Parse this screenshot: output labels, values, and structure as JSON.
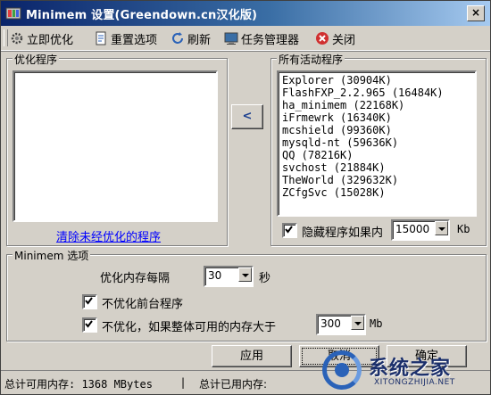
{
  "window": {
    "title": "Minimem 设置(Greendown.cn汉化版)",
    "close_label": "×"
  },
  "toolbar": {
    "optimize_now": "立即优化",
    "reset_options": "重置选项",
    "refresh": "刷新",
    "task_manager": "任务管理器",
    "close": "关闭"
  },
  "optimized_panel": {
    "title": "优化程序",
    "clear_link": "清除未经优化的程序",
    "items": []
  },
  "transfer_button": "<",
  "processes_panel": {
    "title": "所有活动程序",
    "items": [
      "Explorer (30904K)",
      "FlashFXP_2.2.965 (16484K)",
      "ha_minimem (22168K)",
      "iFrmewrk (16340K)",
      "mcshield (99360K)",
      "mysqld-nt (59636K)",
      "QQ (78216K)",
      "svchost (21884K)",
      "TheWorld (329632K)",
      "ZCfgSvc (15028K)"
    ],
    "hide_label": "隐藏程序如果内",
    "hide_checked": true,
    "hide_value": "15000",
    "hide_unit": "Kb"
  },
  "options": {
    "title": "Minimem 选项",
    "interval_label": "优化内存每隔",
    "interval_value": "30",
    "interval_unit": "秒",
    "no_foreground_label": "不优化前台程序",
    "no_foreground_checked": true,
    "threshold_label": "不优化，如果整体可用的内存大于",
    "threshold_checked": true,
    "threshold_value": "300",
    "threshold_unit": "Mb"
  },
  "buttons": {
    "apply": "应用",
    "cancel": "取消",
    "ok": "确定"
  },
  "status": {
    "available": "总计可用内存: 1368 MBytes",
    "separator": "|",
    "used": "总计已用内存:"
  },
  "watermark": {
    "title": "系统之家",
    "subtitle": "XITONGZHIJIA.NET"
  },
  "colors": {
    "face": "#d4d0c8",
    "title_start": "#0a246a",
    "title_end": "#a6caf0",
    "link": "#0000ff"
  }
}
